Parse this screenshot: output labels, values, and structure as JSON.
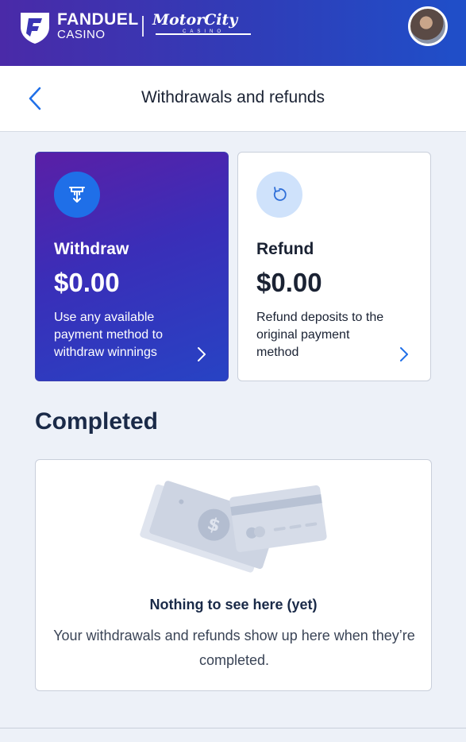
{
  "topbar": {
    "brand_line1": "FANDUEL",
    "brand_line2": "CASINO",
    "partner_name": "MotorCity",
    "partner_sub": "CASINO"
  },
  "header": {
    "title": "Withdrawals and refunds"
  },
  "cards": [
    {
      "title": "Withdraw",
      "amount": "$0.00",
      "description": "Use any available payment method to withdraw winnings",
      "icon": "withdraw-icon"
    },
    {
      "title": "Refund",
      "amount": "$0.00",
      "description": "Refund deposits to the original payment method",
      "icon": "refund-icon"
    }
  ],
  "completed": {
    "heading": "Completed",
    "empty_title": "Nothing to see here (yet)",
    "empty_text": "Your withdrawals and refunds show up here when they’re completed."
  },
  "colors": {
    "brand_gradient_start": "#4a2aa8",
    "brand_gradient_end": "#1f4fc9",
    "accent_blue": "#1f6fe8",
    "background": "#edf1f8"
  }
}
